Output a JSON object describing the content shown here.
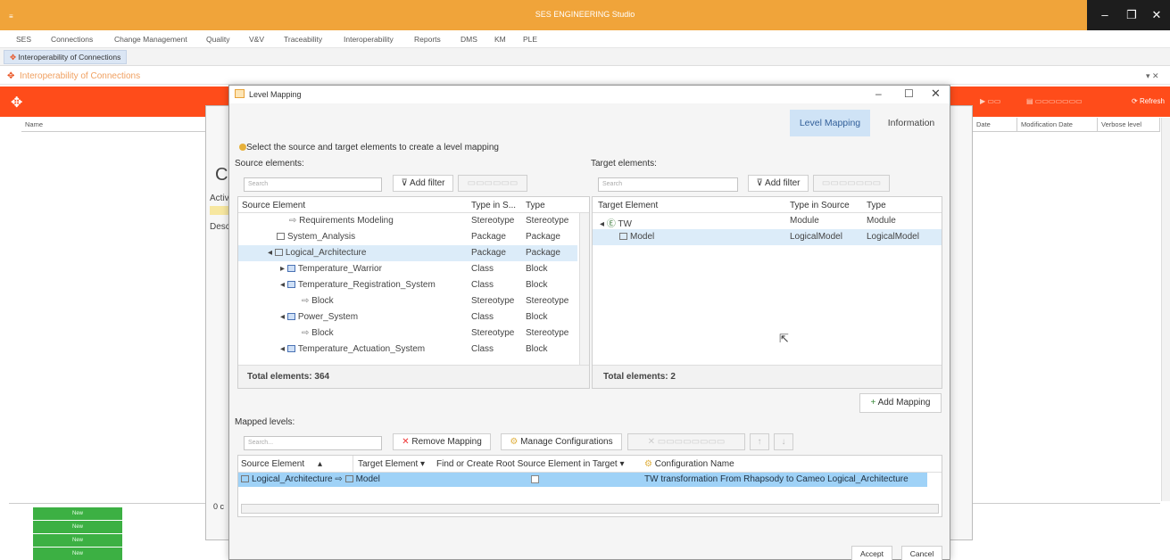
{
  "app": {
    "title": "SES ENGINEERING Studio"
  },
  "menu": [
    "SES",
    "Connections",
    "Change Management",
    "Quality",
    "V&V",
    "Traceability",
    "Interoperability",
    "Reports",
    "DMS",
    "KM",
    "PLE"
  ],
  "tab": {
    "label": "Interoperability of Connections"
  },
  "page": {
    "title": "Interoperability of Connections"
  },
  "toolbar": {
    "refresh": "Refresh"
  },
  "background_columns": {
    "name": "Name",
    "date": "Date",
    "modification_date": "Modification Date",
    "verbose_level": "Verbose level"
  },
  "background_rows": [
    "New",
    "New",
    "New",
    "New"
  ],
  "dialog": {
    "title": "Level Mapping",
    "tabs": {
      "level_mapping": "Level Mapping",
      "information": "Information"
    },
    "instruction": "Select the source and target elements to create a level mapping",
    "source": {
      "label": "Source elements:",
      "search_placeholder": "Search",
      "add_filter": "Add filter",
      "columns": {
        "element": "Source Element",
        "type_in_source": "Type in S...",
        "type": "Type"
      },
      "rows": [
        {
          "name": "Requirements Modeling",
          "type_in_source": "Stereotype",
          "type": "Stereotype"
        },
        {
          "name": "System_Analysis",
          "type_in_source": "Package",
          "type": "Package"
        },
        {
          "name": "Logical_Architecture",
          "type_in_source": "Package",
          "type": "Package"
        },
        {
          "name": "Temperature_Warrior",
          "type_in_source": "Class",
          "type": "Block"
        },
        {
          "name": "Temperature_Registration_System",
          "type_in_source": "Class",
          "type": "Block"
        },
        {
          "name": "Block",
          "type_in_source": "Stereotype",
          "type": "Stereotype"
        },
        {
          "name": "Power_System",
          "type_in_source": "Class",
          "type": "Block"
        },
        {
          "name": "Block",
          "type_in_source": "Stereotype",
          "type": "Stereotype"
        },
        {
          "name": "Temperature_Actuation_System",
          "type_in_source": "Class",
          "type": "Block"
        }
      ],
      "total": "Total elements: 364"
    },
    "target": {
      "label": "Target elements:",
      "search_placeholder": "Search",
      "add_filter": "Add filter",
      "columns": {
        "element": "Target Element",
        "type_in_source": "Type in Source",
        "type": "Type"
      },
      "rows": [
        {
          "name": "TW",
          "type_in_source": "Module",
          "type": "Module"
        },
        {
          "name": "Model",
          "type_in_source": "LogicalModel",
          "type": "LogicalModel"
        }
      ],
      "total": "Total elements: 2"
    },
    "add_mapping": "Add Mapping",
    "mapped": {
      "label": "Mapped levels:",
      "search_placeholder": "Search...",
      "remove_mapping": "Remove Mapping",
      "manage_configurations": "Manage Configurations",
      "columns": {
        "source": "Source Element",
        "target": "Target Element",
        "find_or_create": "Find or Create Root Source Element in Target",
        "config": "Configuration Name"
      },
      "row": {
        "source": "Logical_Architecture",
        "target": "Model",
        "config": "TW transformation From Rhapsody to Cameo Logical_Architecture"
      }
    },
    "accept": "Accept",
    "cancel": "Cancel"
  },
  "colors": {
    "titlebar": "#f0a43a",
    "redbar": "#ff4c1a",
    "selection": "#cde8fb",
    "mapped_selection": "#9fd2f7"
  }
}
